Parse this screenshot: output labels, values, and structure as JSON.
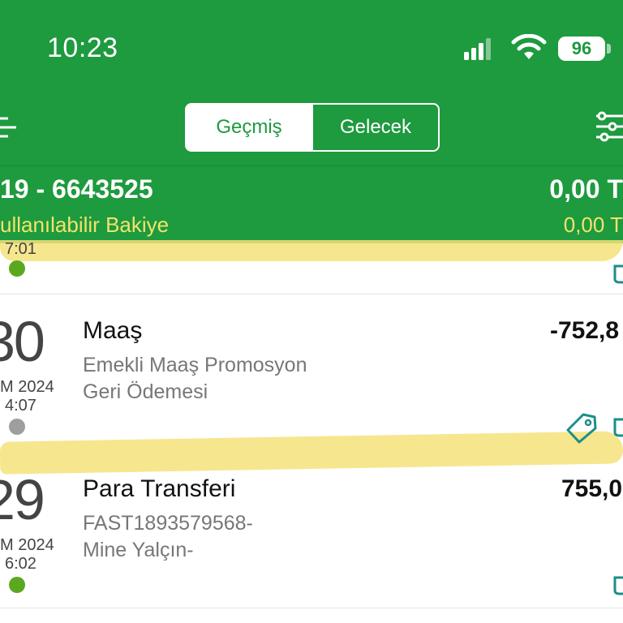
{
  "status_bar": {
    "time": "10:23",
    "battery": "96"
  },
  "tabs": {
    "past": "Geçmiş",
    "future": "Gelecek"
  },
  "account": {
    "number": "19 - 6643525",
    "balance": "0,00 T",
    "available_label": "ullanılabilir Bakiye",
    "available_value": "0,00 T"
  },
  "top_partial": {
    "time": "7:01"
  },
  "transactions": [
    {
      "day": "30",
      "month": "M 2024",
      "time": "4:07",
      "title": "Maaş",
      "description_line1": "Emekli Maaş Promosyon",
      "description_line2": "Geri Ödemesi",
      "amount": "-752,8",
      "status_color": "#9e9e9e"
    },
    {
      "day": "29",
      "month": "M 2024",
      "time": "6:02",
      "title": "Para Transferi",
      "description_line1": "FAST1893579568-",
      "description_line2": "Mine Yalçın-",
      "amount": "755,0",
      "status_color": "#5aa81f"
    }
  ],
  "colors": {
    "brand_green": "#1e9a3f",
    "highlight": "#f5e27a",
    "available_text": "#f3e36a",
    "icon_teal": "#1c8e8a"
  }
}
